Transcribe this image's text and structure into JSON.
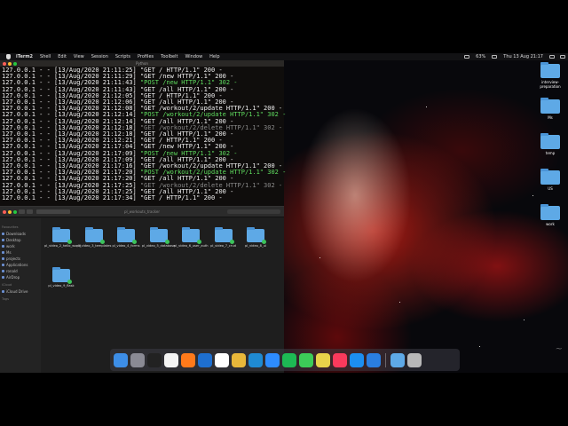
{
  "menubar": {
    "items": [
      "iTerm2",
      "Shell",
      "Edit",
      "View",
      "Session",
      "Scripts",
      "Profiles",
      "Toolbelt",
      "Window",
      "Help"
    ],
    "battery": "63%",
    "clock": "Thu 13 Aug 21:17"
  },
  "terminal": {
    "title": "Python",
    "lines": [
      {
        "prefix": "127.0.0.1 - - [13/Aug/2020 21:11:25] ",
        "req": "\"GET / HTTP/1.1\" 200 -",
        "kind": "plain"
      },
      {
        "prefix": "127.0.0.1 - - [13/Aug/2020 21:11:29] ",
        "req": "\"GET /new HTTP/1.1\" 200 -",
        "kind": "plain"
      },
      {
        "prefix": "127.0.0.1 - - [13/Aug/2020 21:11:43] ",
        "req": "\"POST /new HTTP/1.1\" 302 -",
        "kind": "green"
      },
      {
        "prefix": "127.0.0.1 - - [13/Aug/2020 21:11:43] ",
        "req": "\"GET /all HTTP/1.1\" 200 -",
        "kind": "plain"
      },
      {
        "prefix": "127.0.0.1 - - [13/Aug/2020 21:12:05] ",
        "req": "\"GET / HTTP/1.1\" 200 -",
        "kind": "plain"
      },
      {
        "prefix": "127.0.0.1 - - [13/Aug/2020 21:12:06] ",
        "req": "\"GET /all HTTP/1.1\" 200 -",
        "kind": "plain"
      },
      {
        "prefix": "127.0.0.1 - - [13/Aug/2020 21:12:08] ",
        "req": "\"GET /workout/2/update HTTP/1.1\" 200 -",
        "kind": "plain"
      },
      {
        "prefix": "127.0.0.1 - - [13/Aug/2020 21:12:14] ",
        "req": "\"POST /workout/2/update HTTP/1.1\" 302 -",
        "kind": "green"
      },
      {
        "prefix": "127.0.0.1 - - [13/Aug/2020 21:12:14] ",
        "req": "\"GET /all HTTP/1.1\" 200 -",
        "kind": "plain"
      },
      {
        "prefix": "127.0.0.1 - - [13/Aug/2020 21:12:18] ",
        "req": "\"GET /workout/2/delete HTTP/1.1\" 302 -",
        "kind": "gray"
      },
      {
        "prefix": "127.0.0.1 - - [13/Aug/2020 21:12:18] ",
        "req": "\"GET /all HTTP/1.1\" 200 -",
        "kind": "plain"
      },
      {
        "prefix": "127.0.0.1 - - [13/Aug/2020 21:12:21] ",
        "req": "\"GET / HTTP/1.1\" 200 -",
        "kind": "plain"
      },
      {
        "prefix": "127.0.0.1 - - [13/Aug/2020 21:17:04] ",
        "req": "\"GET /new HTTP/1.1\" 200 -",
        "kind": "plain"
      },
      {
        "prefix": "127.0.0.1 - - [13/Aug/2020 21:17:09] ",
        "req": "\"POST /new HTTP/1.1\" 302 -",
        "kind": "green"
      },
      {
        "prefix": "127.0.0.1 - - [13/Aug/2020 21:17:09] ",
        "req": "\"GET /all HTTP/1.1\" 200 -",
        "kind": "plain"
      },
      {
        "prefix": "127.0.0.1 - - [13/Aug/2020 21:17:16] ",
        "req": "\"GET /workout/2/update HTTP/1.1\" 200 -",
        "kind": "plain"
      },
      {
        "prefix": "127.0.0.1 - - [13/Aug/2020 21:17:20] ",
        "req": "\"POST /workout/2/update HTTP/1.1\" 302 -",
        "kind": "green"
      },
      {
        "prefix": "127.0.0.1 - - [13/Aug/2020 21:17:20] ",
        "req": "\"GET /all HTTP/1.1\" 200 -",
        "kind": "plain"
      },
      {
        "prefix": "127.0.0.1 - - [13/Aug/2020 21:17:25] ",
        "req": "\"GET /workout/2/delete HTTP/1.1\" 302 -",
        "kind": "gray"
      },
      {
        "prefix": "127.0.0.1 - - [13/Aug/2020 21:17:25] ",
        "req": "\"GET /all HTTP/1.1\" 200 -",
        "kind": "plain"
      },
      {
        "prefix": "127.0.0.1 - - [13/Aug/2020 21:17:34] ",
        "req": "\"GET / HTTP/1.1\" 200 -",
        "kind": "plain"
      }
    ]
  },
  "finder": {
    "title": "pl_workouts_tracker",
    "sidebar": [
      {
        "head": "Favourites"
      },
      {
        "label": "Downloads"
      },
      {
        "label": "Desktop"
      },
      {
        "label": "work"
      },
      {
        "label": "Ms"
      },
      {
        "label": "projects"
      },
      {
        "label": "Applications"
      },
      {
        "label": "ronald"
      },
      {
        "label": "AirDrop"
      },
      {
        "head": "iCloud"
      },
      {
        "label": "iCloud Drive"
      },
      {
        "head": "Tags"
      }
    ],
    "files": [
      "pl_video_2_hello_world",
      "pl_video_3_templates",
      "pl_video_4_forms",
      "pl_video_5_database",
      "pl_video_6_user_auth",
      "pl_video_7_crud",
      "pl_video_8_ui",
      "pl_video_9_flask"
    ]
  },
  "desktop": {
    "icons": [
      "interview-preparation",
      "Ms",
      "temp",
      "US",
      "work"
    ]
  },
  "dock": {
    "apps": [
      {
        "name": "finder-icon",
        "color": "#3d8ee8"
      },
      {
        "name": "launchpad-icon",
        "color": "#8a8a94"
      },
      {
        "name": "iterm-icon",
        "color": "#222"
      },
      {
        "name": "calendar-icon",
        "color": "#f4f4f4"
      },
      {
        "name": "firefox-icon",
        "color": "#ff7a1a"
      },
      {
        "name": "outlook-icon",
        "color": "#1e6fd0"
      },
      {
        "name": "notion-icon",
        "color": "#ffffff"
      },
      {
        "name": "chrome-icon",
        "color": "#e8b73a"
      },
      {
        "name": "vscode-icon",
        "color": "#1f8ad2"
      },
      {
        "name": "zoom-icon",
        "color": "#2d8cff"
      },
      {
        "name": "spotify-icon",
        "color": "#1db954"
      },
      {
        "name": "messages-icon",
        "color": "#3ccc58"
      },
      {
        "name": "photos-icon",
        "color": "#e8d24a"
      },
      {
        "name": "music-icon",
        "color": "#fa3a5c"
      },
      {
        "name": "appstore-icon",
        "color": "#1c8ef0"
      },
      {
        "name": "safari-icon",
        "color": "#2a7ee0"
      },
      {
        "name": "downloads-folder-icon",
        "color": "#5ea9e6"
      },
      {
        "name": "trash-icon",
        "color": "#b8b8b8"
      }
    ]
  }
}
